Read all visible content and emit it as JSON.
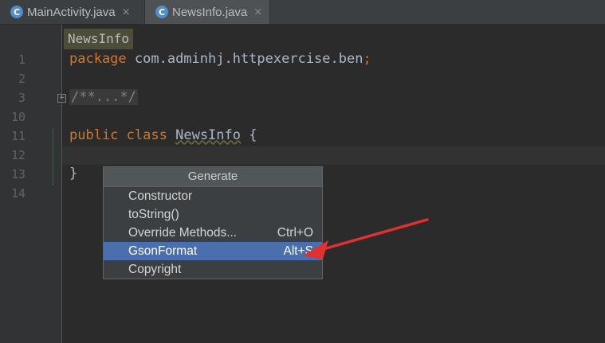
{
  "tabs": [
    {
      "icon": "C",
      "label": "MainActivity.java",
      "close": "×"
    },
    {
      "icon": "C",
      "label": "NewsInfo.java",
      "close": "×"
    }
  ],
  "breadcrumb": "NewsInfo",
  "gutter": {
    "line_numbers": [
      "1",
      "2",
      "3",
      "10",
      "11",
      "12",
      "13",
      "14"
    ]
  },
  "code": {
    "line1_kw": "package",
    "line1_rest": " com.adminhj.httpexercise.ben",
    "line1_semi": ";",
    "line3_fold": "/**...*/",
    "line11_kw1": "public",
    "line11_kw2": "class",
    "line11_class": "NewsInfo",
    "line11_brace": " {",
    "line13_brace": "}"
  },
  "generate_popup": {
    "title": "Generate",
    "items": [
      {
        "label": "Constructor",
        "shortcut": ""
      },
      {
        "label": "toString()",
        "shortcut": ""
      },
      {
        "label": "Override Methods...",
        "shortcut": "Ctrl+O"
      },
      {
        "label": "GsonFormat",
        "shortcut": "Alt+S",
        "selected": true
      },
      {
        "label": "Copyright",
        "shortcut": ""
      }
    ]
  },
  "colors": {
    "keyword": "#cc7832",
    "selection": "#4b6eaf",
    "annotation_arrow": "#e03030"
  }
}
